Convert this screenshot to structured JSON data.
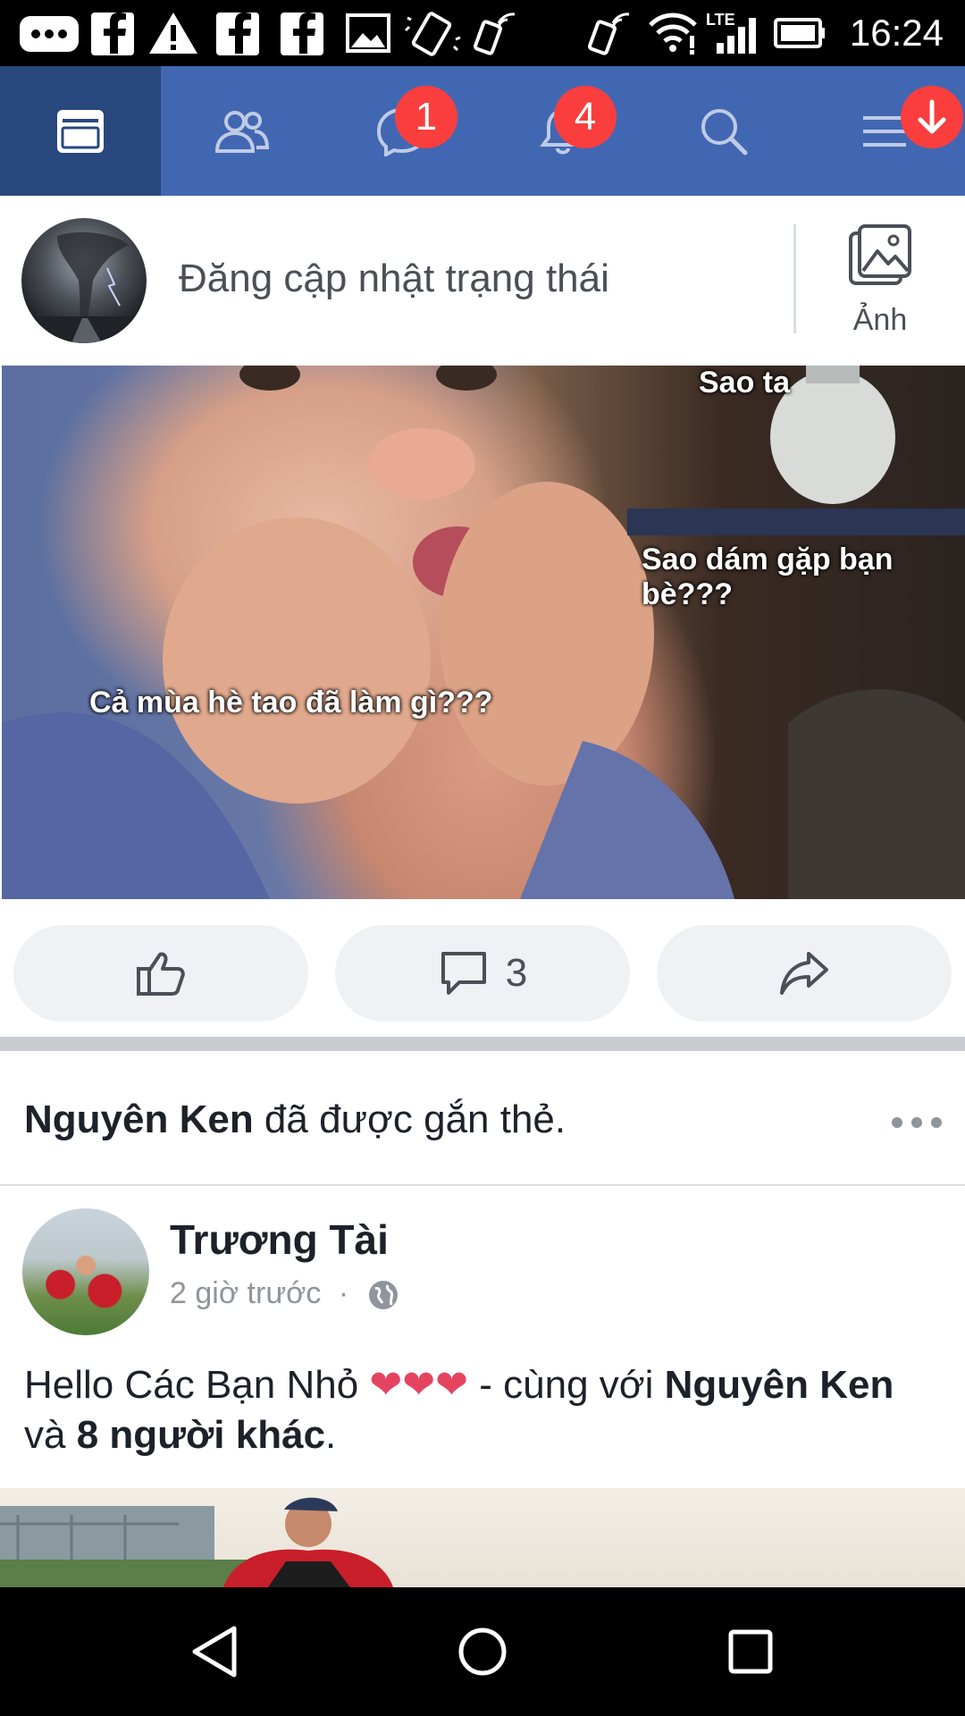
{
  "status_bar": {
    "time": "16:24",
    "network_label": "LTE"
  },
  "nav": {
    "tabs": [
      {
        "name": "news-feed",
        "icon": "news-feed-icon",
        "active": true
      },
      {
        "name": "friend-requests",
        "icon": "friends-icon"
      },
      {
        "name": "messages",
        "icon": "messenger-icon",
        "badge": "1"
      },
      {
        "name": "notifications",
        "icon": "bell-icon",
        "badge": "4"
      },
      {
        "name": "search",
        "icon": "search-icon"
      },
      {
        "name": "menu",
        "icon": "menu-icon"
      }
    ],
    "accent": "#4267b2",
    "badge_color": "#fa3e3e"
  },
  "composer": {
    "placeholder": "Đăng cập nhật trạng thái",
    "photo_label": "Ảnh"
  },
  "post1": {
    "meme_texts": {
      "top": "Sao ta",
      "right": "Sao dám gặp bạn bè???",
      "left": "Cả mùa hè tao đã làm gì???"
    },
    "actions": {
      "comment_count": "3"
    }
  },
  "tagged": {
    "name": "Nguyên Ken",
    "suffix": " đã được gắn thẻ."
  },
  "post2": {
    "author": "Trương Tài",
    "time": "2 giờ trước",
    "separator": "·",
    "body_prefix": "Hello Các Bạn Nhỏ ",
    "hearts": "❤❤❤",
    "body_with": " - cùng với ",
    "tag1": "Nguyên Ken",
    "body_and": " và ",
    "tag2": "8 người khác",
    "body_end": "."
  }
}
